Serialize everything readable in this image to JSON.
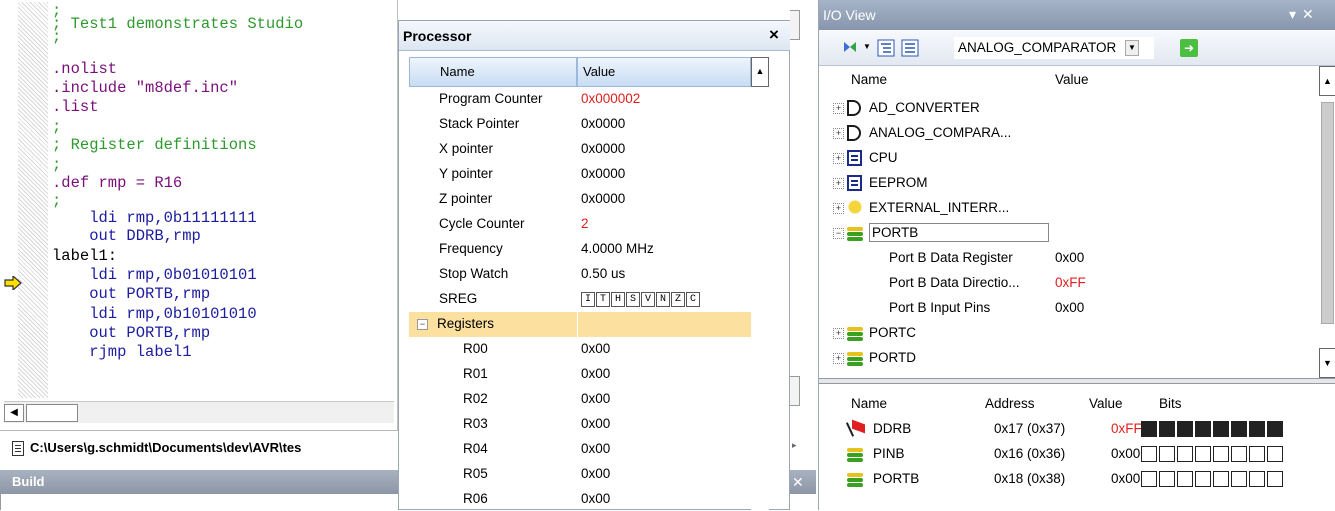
{
  "editor": {
    "lines": [
      {
        "text": ";",
        "kind": "comment"
      },
      {
        "text": "; Test1 demonstrates Studio",
        "kind": "comment"
      },
      {
        "text": ";",
        "kind": "comment"
      },
      {
        "text": ".nolist",
        "kind": "dir"
      },
      {
        "text": ".include \"m8def.inc\"",
        "kind": "dir"
      },
      {
        "text": ".list",
        "kind": "dir"
      },
      {
        "text": ";",
        "kind": "comment"
      },
      {
        "text": "; Register definitions",
        "kind": "comment"
      },
      {
        "text": ";",
        "kind": "comment"
      },
      {
        "text": ".def rmp = R16",
        "kind": "dir"
      },
      {
        "text": ";",
        "kind": "comment"
      },
      {
        "text": "    ldi rmp,0b11111111",
        "kind": "instr"
      },
      {
        "text": "    out DDRB,rmp",
        "kind": "instr"
      },
      {
        "text": "label1:",
        "kind": "plain"
      },
      {
        "text": "    ldi rmp,0b01010101",
        "kind": "instr"
      },
      {
        "text": "    out PORTB,rmp",
        "kind": "instr"
      },
      {
        "text": "    ldi rmp,0b10101010",
        "kind": "instr"
      },
      {
        "text": "    out PORTB,rmp",
        "kind": "instr"
      },
      {
        "text": "    rjmp label1",
        "kind": "instr"
      }
    ],
    "current_line_marker": "yellow-arrow",
    "file_path": "C:\\Users\\g.schmidt\\Documents\\dev\\AVR\\tes"
  },
  "build": {
    "title": "Build"
  },
  "processor": {
    "title": "Processor",
    "close": "×",
    "headers": {
      "name": "Name",
      "value": "Value"
    },
    "rows": [
      {
        "name": "Program Counter",
        "value": "0x000002",
        "highlight": true
      },
      {
        "name": "Stack Pointer",
        "value": "0x0000"
      },
      {
        "name": "X pointer",
        "value": "0x0000"
      },
      {
        "name": "Y pointer",
        "value": "0x0000"
      },
      {
        "name": "Z pointer",
        "value": "0x0000"
      },
      {
        "name": "Cycle Counter",
        "value": "2",
        "highlight": true
      },
      {
        "name": "Frequency",
        "value": "4.0000 MHz"
      },
      {
        "name": "Stop Watch",
        "value": "0.50 us"
      }
    ],
    "sreg": {
      "name": "SREG",
      "flags": [
        "I",
        "T",
        "H",
        "S",
        "V",
        "N",
        "Z",
        "C"
      ]
    },
    "registers_group": "Registers",
    "registers": [
      {
        "name": "R00",
        "value": "0x00"
      },
      {
        "name": "R01",
        "value": "0x00"
      },
      {
        "name": "R02",
        "value": "0x00"
      },
      {
        "name": "R03",
        "value": "0x00"
      },
      {
        "name": "R04",
        "value": "0x00"
      },
      {
        "name": "R05",
        "value": "0x00"
      },
      {
        "name": "R06",
        "value": "0x00"
      }
    ]
  },
  "io_view": {
    "title": "I/O View",
    "selected_module": "ANALOG_COMPARATOR",
    "tree_headers": {
      "name": "Name",
      "value": "Value"
    },
    "tree": [
      {
        "label": "AD_CONVERTER",
        "icon": "ad-icon",
        "toggle": "+"
      },
      {
        "label": "ANALOG_COMPARA...",
        "icon": "ad-icon",
        "toggle": "+"
      },
      {
        "label": "CPU",
        "icon": "cpu-icon",
        "toggle": "+"
      },
      {
        "label": "EEPROM",
        "icon": "cpu-icon",
        "toggle": "+"
      },
      {
        "label": "EXTERNAL_INTERR...",
        "icon": "interrupt-icon",
        "toggle": "+"
      },
      {
        "label": "PORTB",
        "icon": "port-icon",
        "toggle": "−",
        "selected": true
      }
    ],
    "portb_children": [
      {
        "label": "Port B Data Register",
        "value": "0x00"
      },
      {
        "label": "Port B Data Directio...",
        "value": "0xFF",
        "highlight": true
      },
      {
        "label": "Port B Input Pins",
        "value": "0x00"
      }
    ],
    "tree_after": [
      {
        "label": "PORTC",
        "icon": "port-icon",
        "toggle": "+"
      },
      {
        "label": "PORTD",
        "icon": "port-icon",
        "toggle": "+"
      }
    ],
    "bits_headers": {
      "name": "Name",
      "address": "Address",
      "value": "Value",
      "bits": "Bits"
    },
    "bits_rows": [
      {
        "name": "DDRB",
        "address": "0x17 (0x37)",
        "value": "0xFF",
        "highlight": true,
        "bits": [
          1,
          1,
          1,
          1,
          1,
          1,
          1,
          1
        ],
        "icon": "flag-icon"
      },
      {
        "name": "PINB",
        "address": "0x16 (0x36)",
        "value": "0x00",
        "bits": [
          0,
          0,
          0,
          0,
          0,
          0,
          0,
          0
        ],
        "icon": "port-icon"
      },
      {
        "name": "PORTB",
        "address": "0x18 (0x38)",
        "value": "0x00",
        "bits": [
          0,
          0,
          0,
          0,
          0,
          0,
          0,
          0
        ],
        "icon": "port-icon"
      }
    ]
  }
}
